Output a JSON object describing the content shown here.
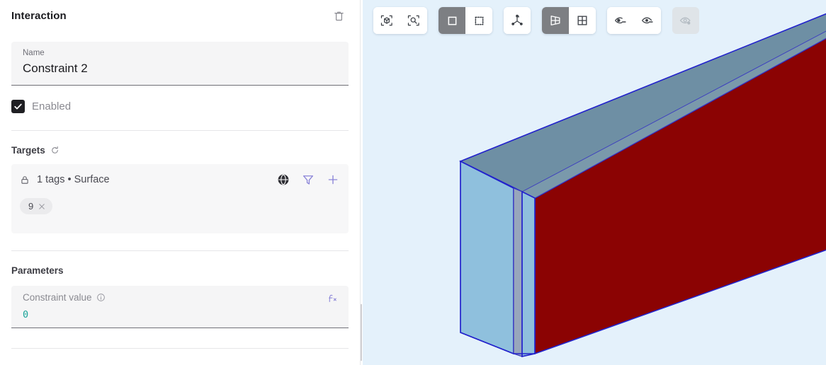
{
  "panel": {
    "header": {
      "title": "Interaction",
      "delete_icon": "trash-icon"
    },
    "name_field": {
      "label": "Name",
      "value": "Constraint 2"
    },
    "enabled": {
      "label": "Enabled",
      "checked": true
    },
    "targets": {
      "section_title": "Targets",
      "refresh_icon": "refresh-icon",
      "lock_icon": "lock-icon",
      "summary": "1 tags • Surface",
      "actions": [
        "globe-icon",
        "filter-icon",
        "plus-icon"
      ],
      "chips": [
        {
          "label": "9",
          "remove_icon": "close-icon"
        }
      ]
    },
    "parameters": {
      "section_title": "Parameters",
      "items": [
        {
          "label": "Constraint value",
          "info_icon": "info-icon",
          "value": "0",
          "formula_icon": "fx-icon"
        }
      ]
    }
  },
  "viewport": {
    "toolbar": [
      {
        "name": "fit-to-view-button",
        "icon": "cube-fit-icon",
        "active": false,
        "disabled": false
      },
      {
        "name": "zoom-to-selection-button",
        "icon": "magnifier-fit-icon",
        "active": false,
        "disabled": false
      },
      {
        "name": "select-solid-button",
        "icon": "square-solid-icon",
        "active": true,
        "disabled": false
      },
      {
        "name": "select-box-button",
        "icon": "square-dashed-icon",
        "active": false,
        "disabled": false
      },
      {
        "name": "axis-triad-button",
        "icon": "axis-triad-icon",
        "active": false,
        "disabled": false
      },
      {
        "name": "perspective-view-button",
        "icon": "perspective-icon",
        "active": true,
        "disabled": false
      },
      {
        "name": "orthographic-view-button",
        "icon": "grid-quad-icon",
        "active": false,
        "disabled": false
      },
      {
        "name": "show-mesh-button",
        "icon": "eye-minus-icon",
        "active": false,
        "disabled": false
      },
      {
        "name": "show-geometry-button",
        "icon": "eye-dot-icon",
        "active": false,
        "disabled": false
      },
      {
        "name": "show-overlay-button",
        "icon": "eye-gear-icon",
        "active": false,
        "disabled": true
      }
    ],
    "colors": {
      "background": "#e4f1fb",
      "face_front": "#8fc0dd",
      "face_top": "#6e8fa4",
      "face_selected": "#8b0303",
      "edge": "#2222cc"
    }
  }
}
